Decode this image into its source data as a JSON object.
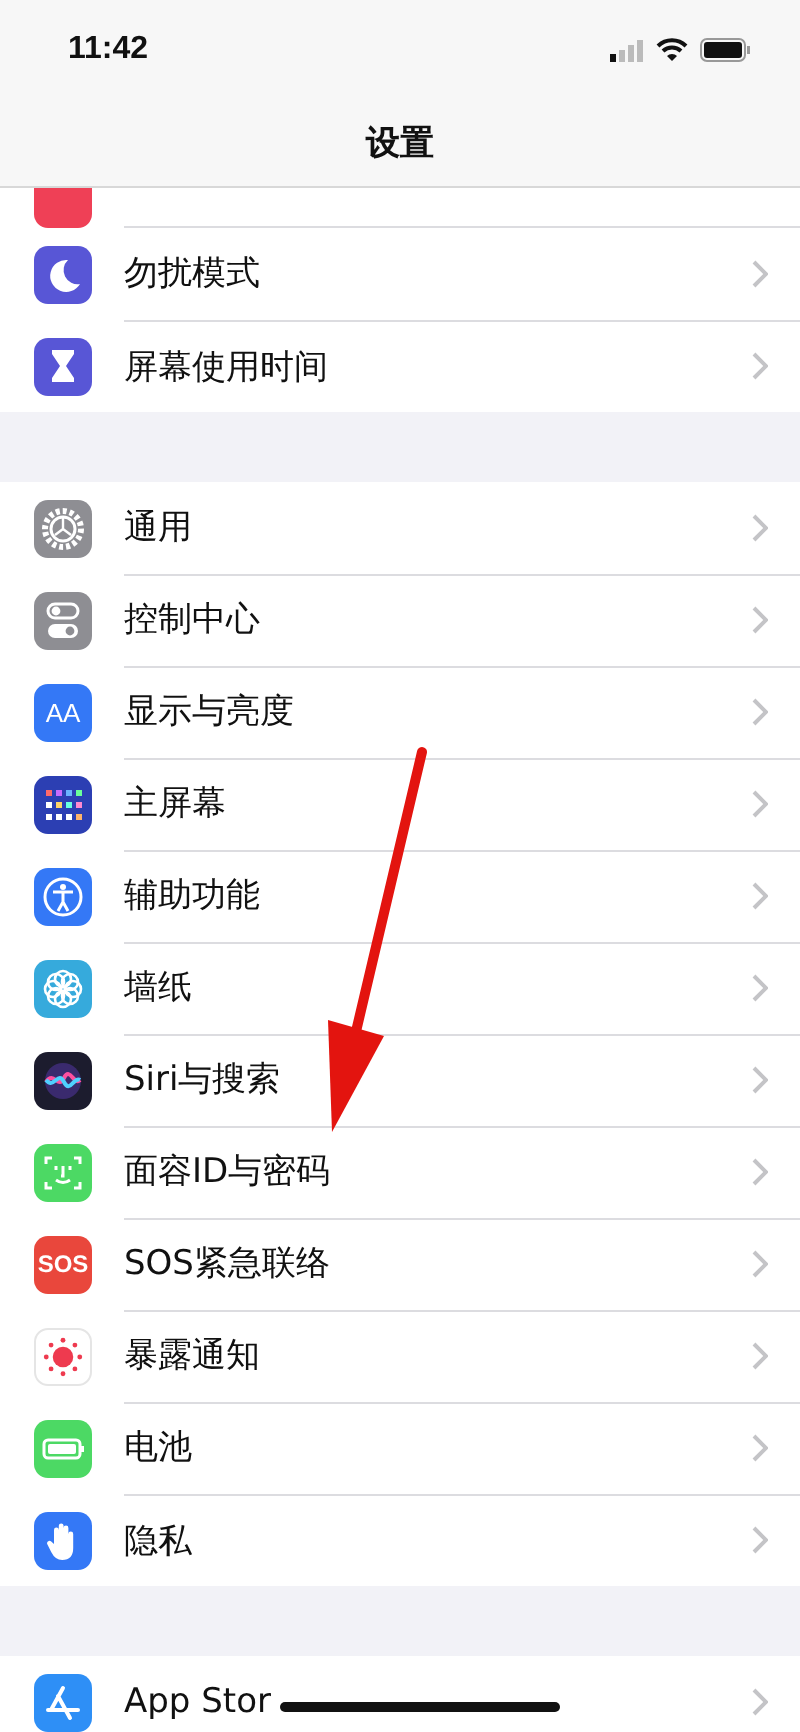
{
  "status_bar": {
    "time": "11:42"
  },
  "nav": {
    "title": "设置"
  },
  "groups": [
    {
      "items": [
        {
          "kind": "sound",
          "cut": true
        },
        {
          "kind": "moon",
          "label": "勿扰模式",
          "cut": false
        },
        {
          "kind": "hourglass",
          "label": "屏幕使用时间",
          "cut": false
        }
      ]
    },
    {
      "items": [
        {
          "kind": "gear",
          "label": "通用",
          "cut": false
        },
        {
          "kind": "toggles",
          "label": "控制中心",
          "cut": false
        },
        {
          "kind": "display",
          "icon_text": "AA",
          "label": "显示与亮度",
          "cut": false
        },
        {
          "kind": "home",
          "label": "主屏幕",
          "cut": false
        },
        {
          "kind": "accessibility",
          "label": "辅助功能",
          "cut": false
        },
        {
          "kind": "flower",
          "label": "墙纸",
          "cut": false
        },
        {
          "kind": "siri",
          "label": "Siri与搜索",
          "cut": false
        },
        {
          "kind": "face",
          "label": "面容ID与密码",
          "cut": false
        },
        {
          "kind": "sos",
          "icon_text": "SOS",
          "label": "SOS紧急联络",
          "cut": false
        },
        {
          "kind": "exposure",
          "label": "暴露通知",
          "cut": false
        },
        {
          "kind": "battery",
          "label": "电池",
          "cut": false
        },
        {
          "kind": "hand",
          "label": "隐私",
          "cut": false
        }
      ]
    },
    {
      "items": [
        {
          "kind": "appstore",
          "label": "App Stor",
          "cut": false
        }
      ]
    }
  ],
  "annotations": [
    {
      "kind": "arrow"
    }
  ]
}
